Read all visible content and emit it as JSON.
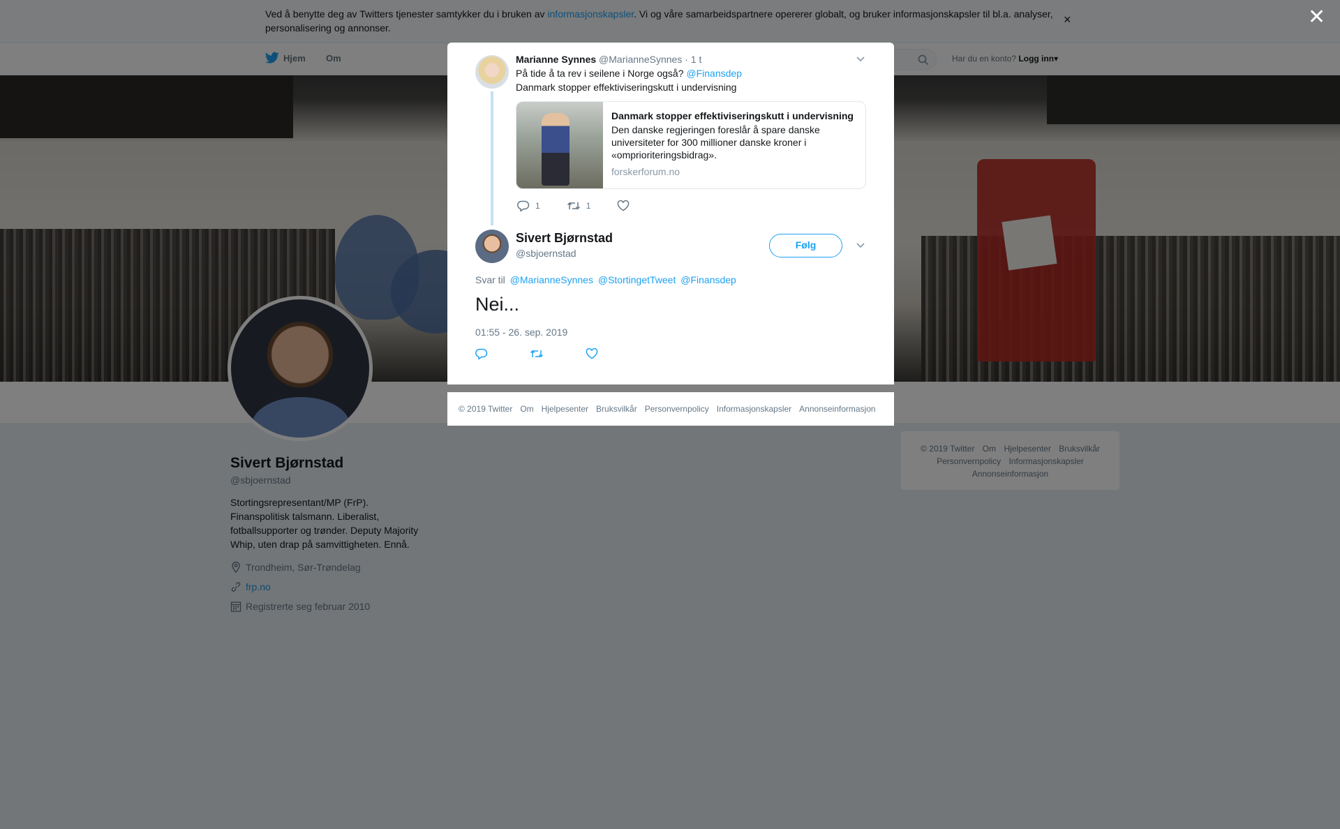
{
  "cookie_banner": {
    "text_before": "Ved å benytte deg av Twitters tjenester samtykker du i bruken av ",
    "link": "informasjonskapsler",
    "text_after": ". Vi og våre samarbeidspartnere opererer globalt, og bruker informasjonskapsler til bl.a. analyser, personalisering og annonser.",
    "close_glyph": "×"
  },
  "nav": {
    "home": "Hjem",
    "about": "Om",
    "login_prompt": "Har du en konto?",
    "login": "Logg inn",
    "login_caret": "▾"
  },
  "profile": {
    "name": "Sivert Bjørnstad",
    "handle": "@sbjoernstad",
    "bio": "Stortingsrepresentant/MP (FrP). Finanspolitisk talsmann. Liberalist, fotballsupporter og trønder. Deputy Majority Whip, uten drap på samvittigheten. Ennå.",
    "location": "Trondheim, Sør-Trøndelag",
    "website": "frp.no",
    "joined": "Registrerte seg februar 2010"
  },
  "side_footer": {
    "items": [
      "© 2019 Twitter",
      "Om",
      "Hjelpesenter",
      "Bruksvilkår",
      "Personvernpolicy",
      "Informasjonskapsler",
      "Annonseinformasjon"
    ]
  },
  "modal": {
    "close_glyph": "✕",
    "parent_tweet": {
      "name": "Marianne Synnes",
      "handle": "@MarianneSynnes",
      "time": "· 1 t",
      "text": "På tide å ta rev i seilene i Norge også?",
      "mention": "@Finansdep",
      "text_line2": "Danmark stopper effektiviseringskutt i undervisning",
      "card": {
        "title": "Danmark stopper effektiviseringskutt i undervisning",
        "description": "Den danske regjeringen foreslår å spare danske universiteter for 300 millioner danske kroner i «omprioriteringsbidrag».",
        "domain": "forskerforum.no"
      },
      "replies": "1",
      "retweets": "1",
      "likes": ""
    },
    "main_tweet": {
      "name": "Sivert Bjørnstad",
      "handle": "@sbjoernstad",
      "follow_label": "Følg",
      "reply_to_label": "Svar til",
      "reply_mentions": [
        "@MarianneSynnes",
        "@StortingetTweet",
        "@Finansdep"
      ],
      "text": "Nei...",
      "timestamp": "01:55 - 26. sep. 2019"
    },
    "footer": [
      "© 2019 Twitter",
      "Om",
      "Hjelpesenter",
      "Bruksvilkår",
      "Personvernpolicy",
      "Informasjonskapsler",
      "Annonseinformasjon"
    ]
  },
  "colors": {
    "accent": "#1da1f2",
    "overlay": "rgba(0,0,0,0.5)"
  },
  "icons": [
    "twitter-bird-icon",
    "search-icon",
    "close-icon",
    "chevron-down-icon",
    "reply-icon",
    "retweet-icon",
    "like-icon",
    "location-icon",
    "link-icon",
    "calendar-icon"
  ]
}
